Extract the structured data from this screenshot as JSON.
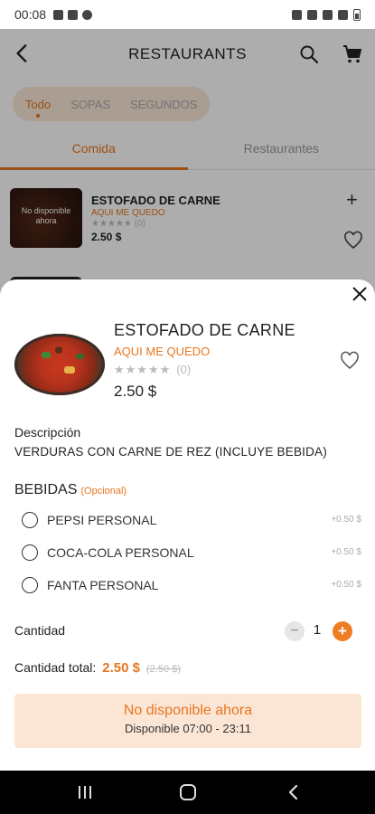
{
  "status_bar": {
    "time": "00:08"
  },
  "header": {
    "title": "RESTAURANTS"
  },
  "categories": [
    {
      "label": "Todo",
      "active": true
    },
    {
      "label": "SOPAS",
      "active": false
    },
    {
      "label": "SEGUNDOS",
      "active": false
    }
  ],
  "tabs": [
    {
      "label": "Comida",
      "active": true
    },
    {
      "label": "Restaurantes",
      "active": false
    }
  ],
  "list_item": {
    "thumb_label": "No disponible ahora",
    "name": "ESTOFADO DE CARNE",
    "restaurant": "AQUI ME QUEDO",
    "stars": "★★★★★",
    "rating_count": "(0)",
    "price": "2.50 $",
    "add_label": "+"
  },
  "sheet": {
    "close_label": "×",
    "name": "ESTOFADO DE CARNE",
    "restaurant": "AQUI ME QUEDO",
    "stars": "★★★★★",
    "rating_count": "(0)",
    "price": "2.50 $",
    "description_label": "Descripción",
    "description": "VERDURAS CON CARNE DE REZ (INCLUYE BEBIDA)",
    "bebidas_title": "BEBIDAS",
    "bebidas_optional": "(Opcional)",
    "options": [
      {
        "name": "PEPSI PERSONAL",
        "price": "+0.50 $"
      },
      {
        "name": "COCA-COLA PERSONAL",
        "price": "+0.50 $"
      },
      {
        "name": "FANTA PERSONAL",
        "price": "+0.50 $"
      }
    ],
    "quantity_label": "Cantidad",
    "quantity_minus": "−",
    "quantity_value": "1",
    "quantity_plus": "+",
    "total_label": "Cantidad total:",
    "total_amount": "2.50 $",
    "total_old": "(2.50 $)",
    "unavailable_title": "No disponible ahora",
    "unavailable_hours": "Disponible 07:00 - 23:11"
  },
  "colors": {
    "accent": "#e8761f",
    "unavailable_bg": "#fbe6d6",
    "chip_bg": "#fbe8d8"
  }
}
